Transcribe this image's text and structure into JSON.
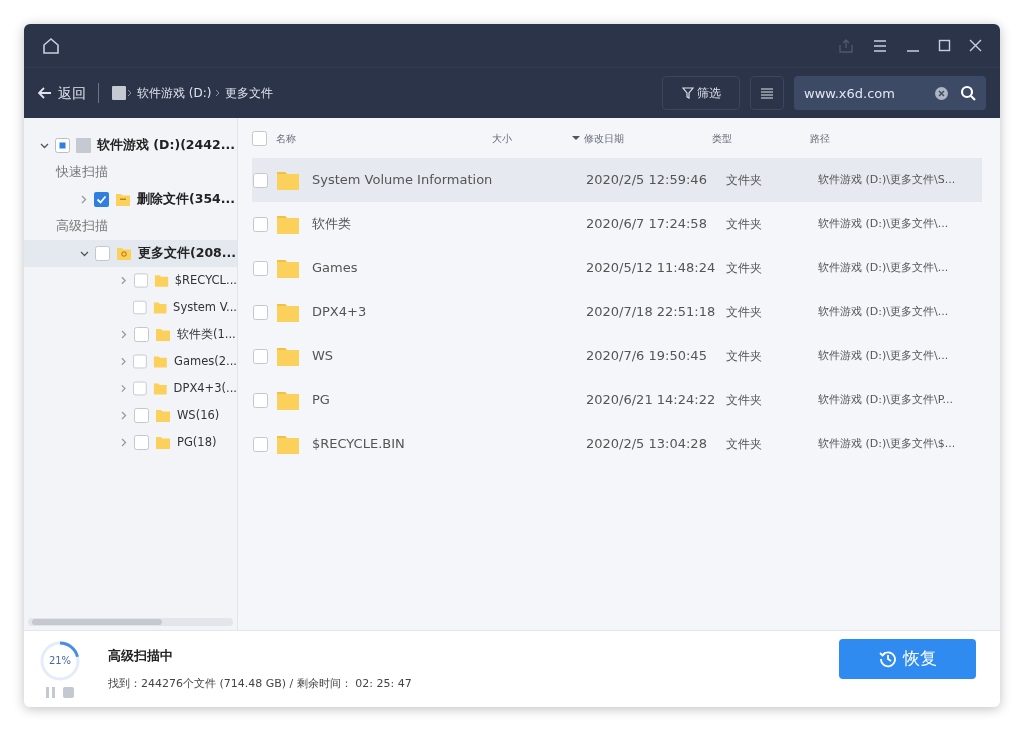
{
  "toolbar": {
    "back": "返回",
    "breadcrumb": [
      "软件游戏 (D:)",
      "更多文件"
    ],
    "filter": "筛选",
    "search": {
      "value": "www.x6d.com"
    }
  },
  "sidebar": {
    "root": {
      "label": "软件游戏 (D:)(2442...",
      "checked": false,
      "indeterminate": true,
      "expanded": true,
      "groups": [
        {
          "label": "快速扫描",
          "items": [
            {
              "label": "删除文件(354...",
              "checked": true,
              "expanded": false,
              "selected": false,
              "kind": "deleted"
            }
          ]
        },
        {
          "label": "高级扫描",
          "items": [
            {
              "label": "更多文件(208...",
              "checked": false,
              "expanded": true,
              "selected": true,
              "kind": "more",
              "children": [
                {
                  "label": "$RECYCL...",
                  "checked": false,
                  "has_children": true
                },
                {
                  "label": "System V...",
                  "checked": false,
                  "has_children": false
                },
                {
                  "label": "软件类(1...",
                  "checked": false,
                  "has_children": true
                },
                {
                  "label": "Games(2...",
                  "checked": false,
                  "has_children": true
                },
                {
                  "label": "DPX4+3(...",
                  "checked": false,
                  "has_children": true
                },
                {
                  "label": "WS(16)",
                  "checked": false,
                  "has_children": true
                },
                {
                  "label": "PG(18)",
                  "checked": false,
                  "has_children": true
                }
              ]
            }
          ]
        }
      ]
    }
  },
  "table": {
    "all_checked": false,
    "columns": [
      "名称",
      "大小",
      "修改日期",
      "类型",
      "路径"
    ],
    "rows": [
      {
        "name": "System Volume Information",
        "date": "2020/2/5 12:59:46",
        "type": "文件夹",
        "path": "软件游戏 (D:)\\更多文件\\S...",
        "selected": true,
        "checked": false
      },
      {
        "name": "软件类",
        "date": "2020/6/7 17:24:58",
        "type": "文件夹",
        "path": "软件游戏 (D:)\\更多文件\\...",
        "selected": false,
        "checked": false
      },
      {
        "name": "Games",
        "date": "2020/5/12 11:48:24",
        "type": "文件夹",
        "path": "软件游戏 (D:)\\更多文件\\...",
        "selected": false,
        "checked": false
      },
      {
        "name": "DPX4+3",
        "date": "2020/7/18 22:51:18",
        "type": "文件夹",
        "path": "软件游戏 (D:)\\更多文件\\...",
        "selected": false,
        "checked": false
      },
      {
        "name": "WS",
        "date": "2020/7/6 19:50:45",
        "type": "文件夹",
        "path": "软件游戏 (D:)\\更多文件\\...",
        "selected": false,
        "checked": false
      },
      {
        "name": "PG",
        "date": "2020/6/21 14:24:22",
        "type": "文件夹",
        "path": "软件游戏 (D:)\\更多文件\\P...",
        "selected": false,
        "checked": false
      },
      {
        "name": "$RECYCLE.BIN",
        "date": "2020/2/5 13:04:28",
        "type": "文件夹",
        "path": "软件游戏 (D:)\\更多文件\\$...",
        "selected": false,
        "checked": false
      }
    ]
  },
  "status": {
    "progress": {
      "level": 0.21,
      "label": "21%"
    },
    "title": "高级扫描中",
    "detail": "找到：244276个文件 (714.48 GB) / 剩余时间： 02: 25: 47",
    "recover": "恢复"
  }
}
